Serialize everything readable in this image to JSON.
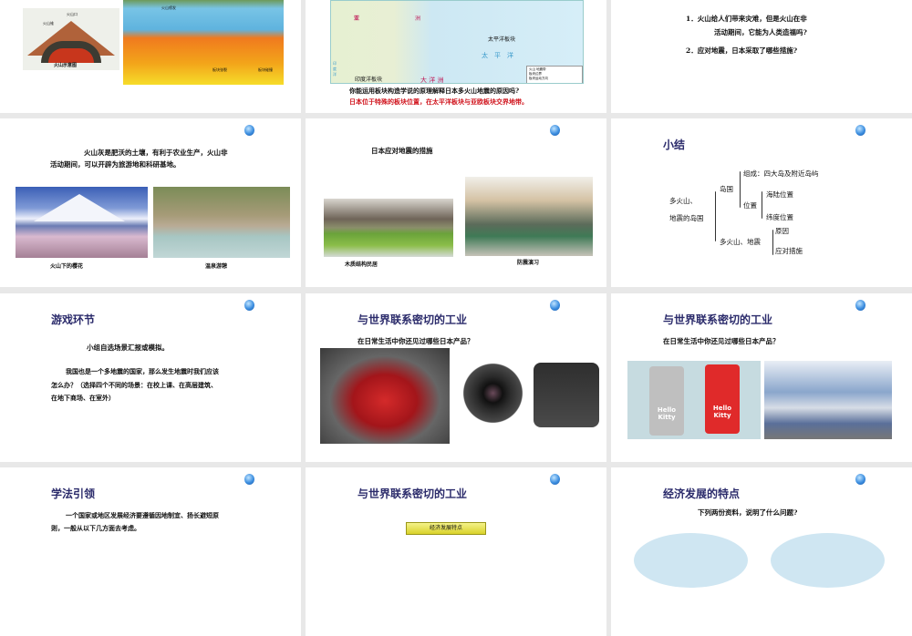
{
  "slides": [
    {
      "labels": {
        "crater": "火山口",
        "cone": "火山锥",
        "volcano_caption": "火山示意图",
        "eruption": "火山喷发",
        "plate_split": "板块张裂",
        "plate_collision": "板块碰撞"
      }
    },
    {
      "map_labels": {
        "asia": "亚",
        "zhou": "洲",
        "pacific_plate": "太平洋板块",
        "pacific_ocean": "太　平　洋",
        "indian_plate": "印度洋板块",
        "indian_ocean": "印度洋",
        "oceania": "大 洋 洲",
        "legend_volcano": "火山",
        "legend_quake": "地震带",
        "legend_boundary": "板块边界",
        "legend_direction": "板块运动方向"
      },
      "question": "你能运用板块构造学说的原理解释日本多火山地震的原因吗?",
      "answer": "日本位于特殊的板块位置，在太平洋板块与亚欧板块交界地带。"
    },
    {
      "q1a": "1．火山给人们带来灾难，但是火山在非",
      "q1b": "活动期间，它能为人类造福吗?",
      "q2": "2．应对地震，日本采取了哪些措施?"
    },
    {
      "line1": "火山灰是肥沃的土壤，有利于农业生产，火山非",
      "line2": "活动期间，可以开辟为旅游地和科研基地。",
      "cap1": "火山下的樱花",
      "cap2": "温泉游憩"
    },
    {
      "title": "日本应对地震的措施",
      "cap1": "木质结构民居",
      "cap2": "防震演习"
    },
    {
      "title": "小结",
      "root1": "多火山、",
      "root2": "地震的岛国",
      "island": "岛国",
      "composition": "组成：四大岛及附近岛屿",
      "position": "位置",
      "sea_land": "海陆位置",
      "latitude": "纬度位置",
      "volcano_quake": "多火山、地震",
      "cause": "原因",
      "measures": "应对措施"
    },
    {
      "title": "游戏环节",
      "line1": "小组自选场景汇报或模拟。",
      "p1": "我国也是一个多地震的国家，那么发生地震时我们应该",
      "p2": "怎么办？（选择四个不同的场景：在校上课、在高层建筑、",
      "p3": "在地下商场、在室外）"
    },
    {
      "title": "与世界联系密切的工业",
      "question": "在日常生活中你还见过哪些日本产品？"
    },
    {
      "title": "与世界联系密切的工业",
      "question": "在日常生活中你还见过哪些日本产品？",
      "kitty1": "Hello Kitty",
      "kitty2": "Hello Kitty"
    },
    {
      "title": "学法引领",
      "p1": "一个国家或地区发展经济要遵循因地制宜、扬长避短原",
      "p2": "则，一般从以下几方面去考虑。"
    },
    {
      "title": "与世界联系密切的工业",
      "button": "经济发展特点"
    },
    {
      "title": "经济发展的特点",
      "question": "下列两份资料，说明了什么问题?"
    }
  ]
}
